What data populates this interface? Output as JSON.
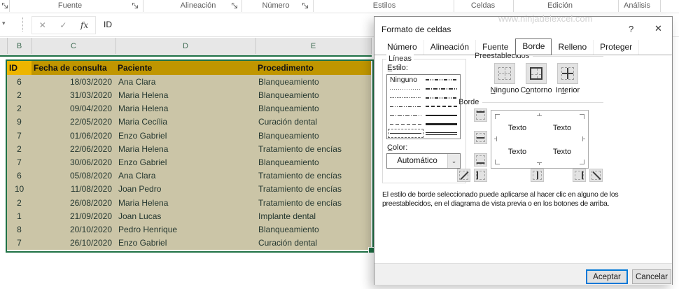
{
  "ribbon": {
    "groups": [
      {
        "label": "Fuente"
      },
      {
        "label": "Alineación"
      },
      {
        "label": "Número"
      },
      {
        "label": "Estilos"
      },
      {
        "label": "Celdas"
      },
      {
        "label": "Edición"
      },
      {
        "label": "Análisis"
      }
    ]
  },
  "formula_bar": {
    "cancel_icon": "✕",
    "enter_icon": "✓",
    "fx_label": "fx",
    "name_box_arrow": "▾",
    "value": "ID"
  },
  "sheet": {
    "columns": [
      "B",
      "C",
      "D",
      "E"
    ]
  },
  "table": {
    "headers": {
      "id": "ID",
      "fecha": "Fecha de consulta",
      "paciente": "Paciente",
      "procedimiento": "Procedimento"
    },
    "rows": [
      {
        "id": "6",
        "fecha": "18/03/2020",
        "paciente": "Ana Clara",
        "procedimiento": "Blanqueamiento"
      },
      {
        "id": "2",
        "fecha": "31/03/2020",
        "paciente": "Maria Helena",
        "procedimiento": "Blanqueamiento"
      },
      {
        "id": "2",
        "fecha": "09/04/2020",
        "paciente": "Maria Helena",
        "procedimiento": "Blanqueamiento"
      },
      {
        "id": "9",
        "fecha": "22/05/2020",
        "paciente": "Maria Cecília",
        "procedimiento": "Curación dental"
      },
      {
        "id": "7",
        "fecha": "01/06/2020",
        "paciente": "Enzo Gabriel",
        "procedimiento": "Blanqueamiento"
      },
      {
        "id": "2",
        "fecha": "22/06/2020",
        "paciente": "Maria Helena",
        "procedimiento": "Tratamiento de encías"
      },
      {
        "id": "7",
        "fecha": "30/06/2020",
        "paciente": "Enzo Gabriel",
        "procedimiento": "Blanqueamiento"
      },
      {
        "id": "6",
        "fecha": "05/08/2020",
        "paciente": "Ana Clara",
        "procedimiento": "Tratamiento de encías"
      },
      {
        "id": "10",
        "fecha": "11/08/2020",
        "paciente": "Joan Pedro",
        "procedimiento": "Tratamiento de encías"
      },
      {
        "id": "2",
        "fecha": "26/08/2020",
        "paciente": "Maria Helena",
        "procedimiento": "Tratamiento de encías"
      },
      {
        "id": "1",
        "fecha": "21/09/2020",
        "paciente": "Joan Lucas",
        "procedimiento": "Implante dental"
      },
      {
        "id": "8",
        "fecha": "20/10/2020",
        "paciente": "Pedro Henrique",
        "procedimiento": "Blanqueamiento"
      },
      {
        "id": "7",
        "fecha": "26/10/2020",
        "paciente": "Enzo Gabriel",
        "procedimiento": "Curación dental"
      }
    ]
  },
  "dialog": {
    "title": "Formato de celdas",
    "watermark": "www.ninjadelexcel.com",
    "help_icon": "?",
    "close_icon": "✕",
    "tabs": [
      "Número",
      "Alineación",
      "Fuente",
      "Borde",
      "Relleno",
      "Proteger"
    ],
    "active_tab": "Borde",
    "lineas": {
      "title": "Líneas",
      "estilo_label": "E̲stilo:",
      "none_option": "Ninguno",
      "color_label": "C̲olor:",
      "color_value": "Automático",
      "combo_arrow": "⌄"
    },
    "presets": {
      "title": "Preestablecidos",
      "ninguno": "N̲inguno",
      "contorno": "Co̲ntorno",
      "interior": "Int̲erior"
    },
    "borde": {
      "title": "Borde",
      "texto": "Texto"
    },
    "description": "El estilo de borde seleccionado puede aplicarse al hacer clic en alguno de los preestablecidos, en el diagrama de vista previa o en los botones de arriba.",
    "ok_label": "Aceptar",
    "cancel_label": "Cancelar"
  },
  "colors": {
    "selection_green": "#1E7145",
    "header_gold": "#C09600",
    "active_cell_gold": "#EDB500",
    "row_tan": "#CBC5A7",
    "accent_blue": "#0078D7"
  }
}
